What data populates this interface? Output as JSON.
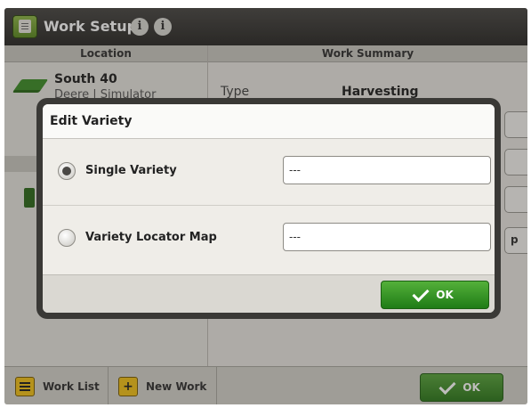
{
  "header": {
    "title": "Work Setup",
    "info_icon_glyph": "i",
    "help_icon_glyph": "i"
  },
  "location": {
    "header": "Location",
    "name": "South 40",
    "subtitle": "Deere | Simulator"
  },
  "work_summary": {
    "header": "Work Summary",
    "type_label": "Type",
    "type_value": "Harvesting",
    "partial_button_label": "p"
  },
  "footer": {
    "work_list_label": "Work List",
    "new_work_label": "New Work",
    "new_work_glyph": "+",
    "ok_label": "OK"
  },
  "dialog": {
    "title": "Edit Variety",
    "options": [
      {
        "label": "Single Variety",
        "value": "---",
        "selected": true
      },
      {
        "label": "Variety Locator Map",
        "value": "---",
        "selected": false
      }
    ],
    "ok_label": "OK"
  },
  "colors": {
    "header_bg": "#2c2b29",
    "accent_green": "#2f7a1e",
    "footer_icon_yellow": "#f2c21a"
  }
}
